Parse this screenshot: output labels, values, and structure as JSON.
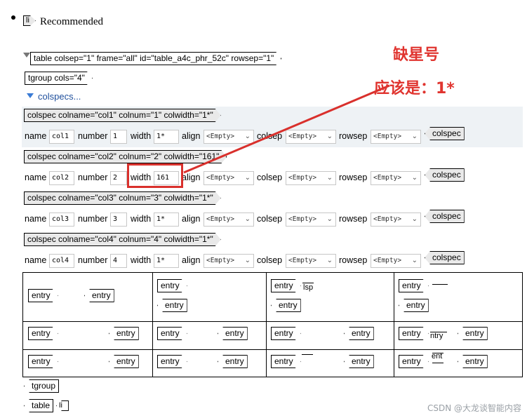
{
  "li": {
    "tag": "li",
    "text": "Recommended"
  },
  "table_tag": "table colsep=\"1\" frame=\"all\" id=\"table_a4c_phr_52c\" rowsep=\"1\"",
  "tgroup_tag": "tgroup cols=\"4\"",
  "colspecs_label": "colspecs...",
  "field_labels": {
    "name": "name",
    "number": "number",
    "width": "width",
    "align": "align",
    "colsep": "colsep",
    "rowsep": "rowsep"
  },
  "empty_option": "<Empty>",
  "colspec_end": "colspec",
  "colspecs": [
    {
      "tag": "colspec colname=\"col1\" colnum=\"1\" colwidth=\"1*\"",
      "name": "col1",
      "number": "1",
      "width": "1*"
    },
    {
      "tag": "colspec colname=\"col2\" colnum=\"2\" colwidth=\"161\"",
      "name": "col2",
      "number": "2",
      "width": "161"
    },
    {
      "tag": "colspec colname=\"col3\" colnum=\"3\" colwidth=\"1*\"",
      "name": "col3",
      "number": "3",
      "width": "1*"
    },
    {
      "tag": "colspec colname=\"col4\" colnum=\"4\" colwidth=\"1*\"",
      "name": "col4",
      "number": "4",
      "width": "1*"
    }
  ],
  "entry": "entry",
  "cell_fragments": {
    "r1c3": "lsp",
    "r2c4": "ntry",
    "r3c4": "ent"
  },
  "end_tags": {
    "tgroup": "tgroup",
    "table": "table",
    "li": "li"
  },
  "annotation": {
    "line1": "缺星号",
    "line2": "应该是：1*",
    "color": "#d9302c"
  },
  "watermark": "CSDN @大龙谈智能内容"
}
